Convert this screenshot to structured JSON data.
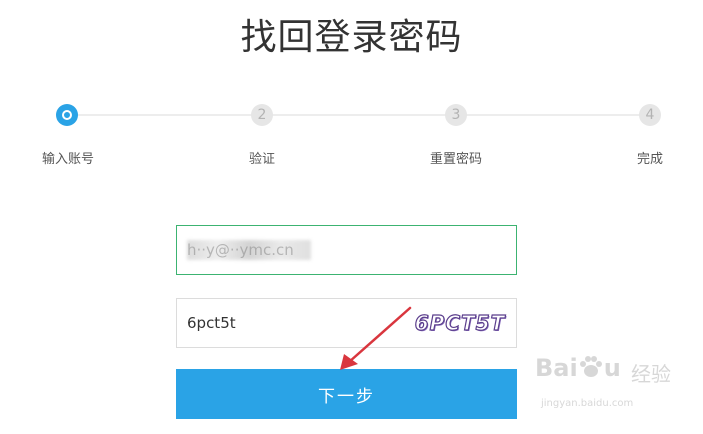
{
  "page": {
    "title": "找回登录密码"
  },
  "steps": [
    {
      "number": "",
      "label": "输入账号",
      "state": "active"
    },
    {
      "number": "2",
      "label": "验证",
      "state": "pending"
    },
    {
      "number": "3",
      "label": "重置密码",
      "state": "pending"
    },
    {
      "number": "4",
      "label": "完成",
      "state": "pending"
    }
  ],
  "form": {
    "email_value": "h··y@··ymc.cn",
    "captcha_value": "6pct5t",
    "captcha_image_text": "6PCT5T",
    "next_button_label": "下一步"
  },
  "colors": {
    "accent": "#2aa3e6",
    "email_border": "#3cb371",
    "annotation_arrow": "#d9363e"
  },
  "watermark": {
    "logo_text": "Bai",
    "logo_text_2": "u",
    "sub_text": "经验",
    "url": "jingyan.baidu.com"
  }
}
